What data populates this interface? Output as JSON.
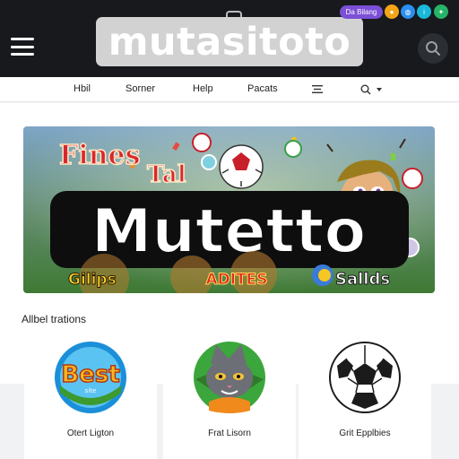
{
  "header": {
    "logo_text": "mutasitoto",
    "promo_badge": "Da Bilang",
    "colors": {
      "bar": "#17191d",
      "logo_box": "#d2d2d2",
      "badge": "#7b4fd6"
    },
    "icons": [
      "menu-icon",
      "search-icon",
      "coin-icon",
      "globe-icon",
      "info-icon",
      "chat-icon"
    ]
  },
  "nav": {
    "items": [
      "Hbil",
      "Sorner",
      "Help",
      "Pacats"
    ],
    "icons": [
      "list-icon",
      "search-icon",
      "chevron-down-icon"
    ]
  },
  "banner": {
    "headline": "Mutetto",
    "top_text_1": "Fines",
    "top_text_2": "Tal",
    "bottom_left": "Gilips",
    "bottom_center": "ADITES",
    "bottom_right": "Sallds"
  },
  "section": {
    "title": "Allbel trations"
  },
  "cards": [
    {
      "label": "Otert Ligton",
      "art_text": "Best",
      "art_subtext": "site",
      "icon": "best-badge-icon"
    },
    {
      "label": "Frat Lisorn",
      "icon": "cat-mascot-icon"
    },
    {
      "label": "Grit Epplbies",
      "icon": "soccer-ball-icon"
    }
  ]
}
